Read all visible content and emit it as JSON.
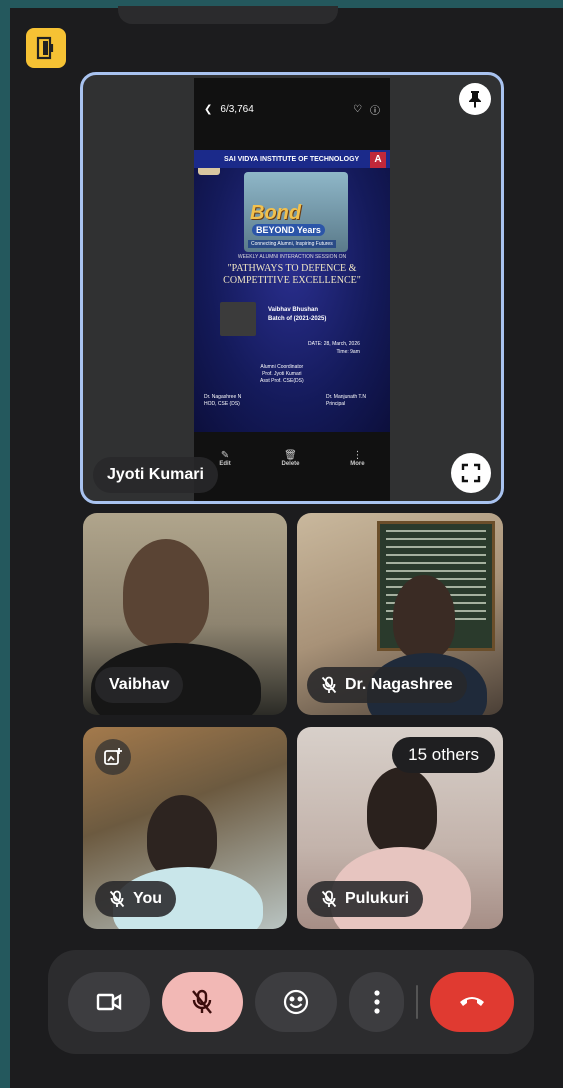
{
  "main_tile": {
    "presenter": "Jyoti Kumari",
    "shared_screen": {
      "counter": "6/3,764",
      "poster": {
        "institute": "SAI VIDYA INSTITUTE OF TECHNOLOGY",
        "logo_letter": "A",
        "bond_title": "Bond",
        "bond_sub": "BEYOND Years",
        "bond_tagline": "Connecting Alumni, Inspiring Futures",
        "session_label": "WEEKLY ALUMNI INTERACTION SESSION ON",
        "session_title": "\"PATHWAYS TO DEFENCE & COMPETITIVE EXCELLENCE\"",
        "speaker_name": "Vaibhav Bhushan",
        "speaker_batch": "Batch of (2021-2025)",
        "date": "DATE: 28, March, 2026",
        "time": "Time: 9am",
        "coordinator_label": "Alumni Coordinator",
        "coordinator_name": "Prof. Jyoti Kumari",
        "coordinator_role": "Asst Prof. CSE(DS)",
        "hod_name": "Dr. Nagashree N",
        "hod_role": "HOD, CSE (DS)",
        "principal_name": "Dr. Manjunath T.N",
        "principal_role": "Principal"
      },
      "actions": [
        "Edit",
        "Delete",
        "More"
      ]
    }
  },
  "participants": [
    {
      "name": "Vaibhav",
      "muted": false
    },
    {
      "name": "Dr. Nagashree",
      "muted": true
    },
    {
      "name": "You",
      "muted": true
    },
    {
      "name": "Pulukuri",
      "muted": true
    }
  ],
  "others_count": "15 others",
  "colors": {
    "background": "#24585d",
    "accent_border": "#a9c3f0",
    "mic_muted_bg": "#f2b8b5",
    "hangup": "#e03a31",
    "leave_icon_bg": "#f6c234"
  },
  "icons": {
    "leave": "door-exit-icon",
    "pin": "pin-icon",
    "fullscreen": "fullscreen-icon",
    "camera": "video-camera-icon",
    "mic": "mic-off-icon",
    "emoji": "emoji-icon",
    "more": "more-vertical-icon",
    "hangup": "call-end-icon"
  }
}
